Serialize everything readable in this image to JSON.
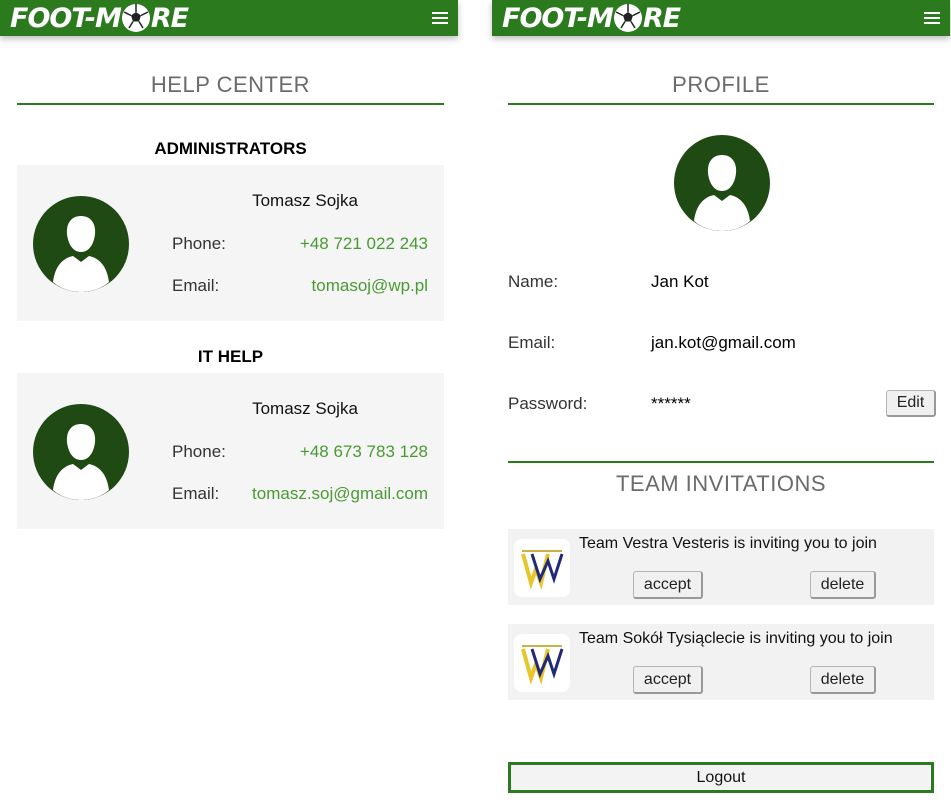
{
  "app": {
    "logo_text_1": "FOOT-M",
    "logo_text_2": "RE"
  },
  "help_center": {
    "title": "HELP CENTER",
    "sections": [
      {
        "heading": "ADMINISTRATORS",
        "name": "Tomasz Sojka",
        "phone_label": "Phone:",
        "phone": "+48 721 022 243",
        "email_label": "Email:",
        "email": "tomasoj@wp.pl"
      },
      {
        "heading": "IT HELP",
        "name": "Tomasz Sojka",
        "phone_label": "Phone:",
        "phone": "+48 673 783 128",
        "email_label": "Email:",
        "email": "tomasz.soj@gmail.com"
      }
    ]
  },
  "profile": {
    "title": "PROFILE",
    "name_label": "Name:",
    "name": "Jan Kot",
    "email_label": "Email:",
    "email": "jan.kot@gmail.com",
    "password_label": "Password:",
    "password": "******",
    "edit_label": "Edit"
  },
  "team_invitations": {
    "title": "TEAM INVITATIONS",
    "invites": [
      {
        "text": "Team Vestra Vesteris is inviting you to join",
        "accept": "accept",
        "delete": "delete"
      },
      {
        "text": "Team Sokół Tysiąclecie is inviting you to join",
        "accept": "accept",
        "delete": "delete"
      }
    ]
  },
  "logout_label": "Logout",
  "colors": {
    "brand_green": "#2c7a1e",
    "avatar_green": "#1f4a13",
    "link_green": "#4a9a33"
  }
}
